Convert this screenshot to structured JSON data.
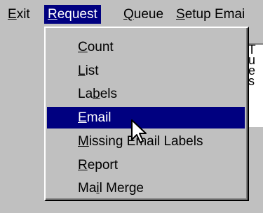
{
  "menubar": {
    "items": [
      {
        "pre": "",
        "key": "E",
        "post": "xit"
      },
      {
        "pre": "",
        "key": "R",
        "post": "equest"
      },
      {
        "pre": "",
        "key": "Q",
        "post": "ueue"
      },
      {
        "pre": "",
        "key": "S",
        "post": "etup Emai"
      }
    ],
    "active_index": 1
  },
  "background_panel": {
    "lines": [
      ":  T",
      "qu",
      "be",
      "es"
    ]
  },
  "dropdown": {
    "items": [
      {
        "pre": "",
        "key": "C",
        "post": "ount"
      },
      {
        "pre": "",
        "key": "L",
        "post": "ist"
      },
      {
        "pre": "La",
        "key": "b",
        "post": "els"
      },
      {
        "pre": "",
        "key": "E",
        "post": "mail"
      },
      {
        "pre": "",
        "key": "M",
        "post": "issing Email Labels"
      },
      {
        "pre": "",
        "key": "R",
        "post": "eport"
      },
      {
        "pre": "Ma",
        "key": "i",
        "post": "l Merge"
      }
    ],
    "highlighted_index": 3
  },
  "colors": {
    "menu_bg": "#c0c0c0",
    "highlight_bg": "#000080",
    "highlight_text": "#ffffff"
  },
  "cursor": {
    "icon": "arrow-pointer-icon"
  }
}
